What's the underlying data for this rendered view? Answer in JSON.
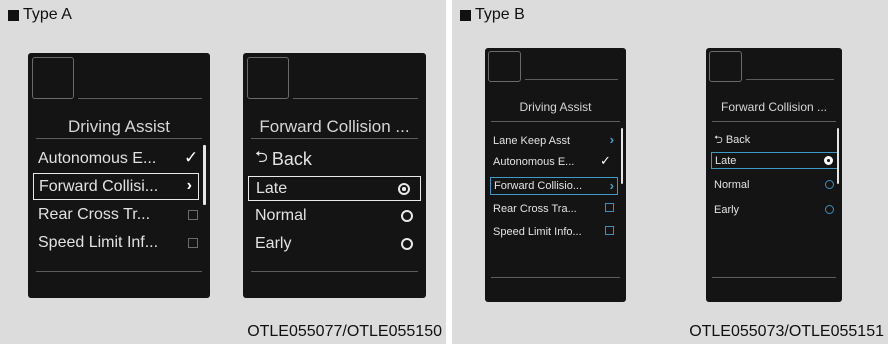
{
  "type_a": {
    "label": "Type A",
    "code": "OTLE055077/OTLE055150",
    "menu": {
      "title": "Driving Assist",
      "items": [
        {
          "label": "Autonomous E...",
          "control": "checkbox",
          "checked": true
        },
        {
          "label": "Forward Collisi...",
          "control": "chevron",
          "selected": true
        },
        {
          "label": "Rear Cross Tr...",
          "control": "checkbox",
          "checked": false
        },
        {
          "label": "Speed Limit Inf...",
          "control": "checkbox",
          "checked": false
        }
      ]
    },
    "submenu": {
      "title": "Forward Collision ...",
      "back_label": "Back",
      "options": [
        {
          "label": "Late",
          "selected": true
        },
        {
          "label": "Normal",
          "selected": false
        },
        {
          "label": "Early",
          "selected": false
        }
      ]
    }
  },
  "type_b": {
    "label": "Type B",
    "code": "OTLE055073/OTLE055151",
    "menu": {
      "title": "Driving Assist",
      "items": [
        {
          "label": "Lane Keep Asst",
          "control": "chevron"
        },
        {
          "label": "Autonomous E...",
          "control": "checkbox",
          "checked": true
        },
        {
          "label": "Forward Collisio...",
          "control": "chevron",
          "selected": true
        },
        {
          "label": "Rear Cross Tra...",
          "control": "checkbox",
          "checked": false
        },
        {
          "label": "Speed Limit Info...",
          "control": "checkbox",
          "checked": false
        }
      ]
    },
    "submenu": {
      "title": "Forward Collision ...",
      "back_label": "Back",
      "options": [
        {
          "label": "Late",
          "selected": true
        },
        {
          "label": "Normal",
          "selected": false
        },
        {
          "label": "Early",
          "selected": false
        }
      ]
    }
  },
  "icons": {
    "back": "back-arrow-icon",
    "chevron": "chevron-right-icon",
    "check": "checkmark-icon",
    "radio_on": "radio-selected-icon",
    "radio_off": "radio-unselected-icon"
  },
  "colors": {
    "screen_bg": "#141414",
    "panel_bg": "#dcdcdc",
    "type_b_accent": "#3e9bc8"
  }
}
